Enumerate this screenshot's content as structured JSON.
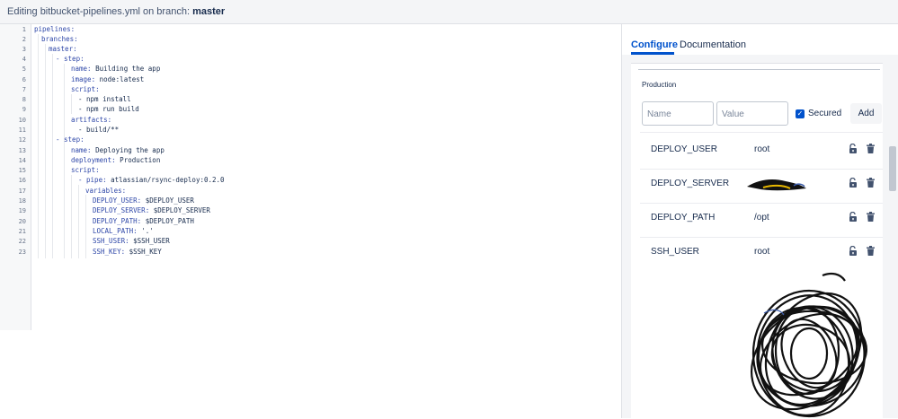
{
  "header": {
    "prefix": "Editing bitbucket-pipelines.yml on branch:",
    "branch": "master"
  },
  "editor": {
    "line_numbers": [
      "1",
      "2",
      "3",
      "4",
      "5",
      "6",
      "7",
      "8",
      "9",
      "10",
      "11",
      "12",
      "13",
      "14",
      "15",
      "16",
      "17",
      "18",
      "19",
      "20",
      "21",
      "22",
      "23"
    ],
    "lines": [
      {
        "key": "pipelines:",
        "val": ""
      },
      {
        "key": "branches:",
        "val": ""
      },
      {
        "key": "master:",
        "val": ""
      },
      {
        "key": "- step:",
        "val": ""
      },
      {
        "key": "name:",
        "val": " Building the app"
      },
      {
        "key": "image:",
        "val": " node:latest"
      },
      {
        "key": "script:",
        "val": ""
      },
      {
        "key": "",
        "val": "- npm install"
      },
      {
        "key": "",
        "val": "- npm run build"
      },
      {
        "key": "artifacts:",
        "val": ""
      },
      {
        "key": "",
        "val": "- build/**"
      },
      {
        "key": "- step:",
        "val": ""
      },
      {
        "key": "name:",
        "val": " Deploying the app"
      },
      {
        "key": "deployment:",
        "val": " Production"
      },
      {
        "key": "script:",
        "val": ""
      },
      {
        "key": "- pipe:",
        "val": " atlassian/rsync-deploy:0.2.0"
      },
      {
        "key": "variables:",
        "val": ""
      },
      {
        "key": "DEPLOY_USER:",
        "val": " $DEPLOY_USER"
      },
      {
        "key": "DEPLOY_SERVER:",
        "val": " $DEPLOY_SERVER"
      },
      {
        "key": "DEPLOY_PATH:",
        "val": " $DEPLOY_PATH"
      },
      {
        "key": "LOCAL_PATH:",
        "val": " '.'"
      },
      {
        "key": "SSH_USER:",
        "val": " $SSH_USER"
      },
      {
        "key": "SSH_KEY:",
        "val": " $SSH_KEY"
      }
    ]
  },
  "tabs": {
    "configure": "Configure",
    "documentation": "Documentation"
  },
  "deployments": {
    "environment": "Production",
    "name_placeholder": "Name",
    "value_placeholder": "Value",
    "secured_label": "Secured",
    "secured_checked": true,
    "add_label": "Add",
    "variables": [
      {
        "name": "DEPLOY_USER",
        "value": "root"
      },
      {
        "name": "DEPLOY_SERVER",
        "value": ""
      },
      {
        "name": "DEPLOY_PATH",
        "value": "/opt"
      },
      {
        "name": "SSH_USER",
        "value": "root"
      }
    ]
  },
  "colors": {
    "accent": "#0052cc",
    "yaml_key": "#2e47a8",
    "redaction": "#111111"
  },
  "icons": {
    "lock": "unlocked-padlock-icon",
    "delete": "trash-icon",
    "check": "checkmark-icon"
  }
}
